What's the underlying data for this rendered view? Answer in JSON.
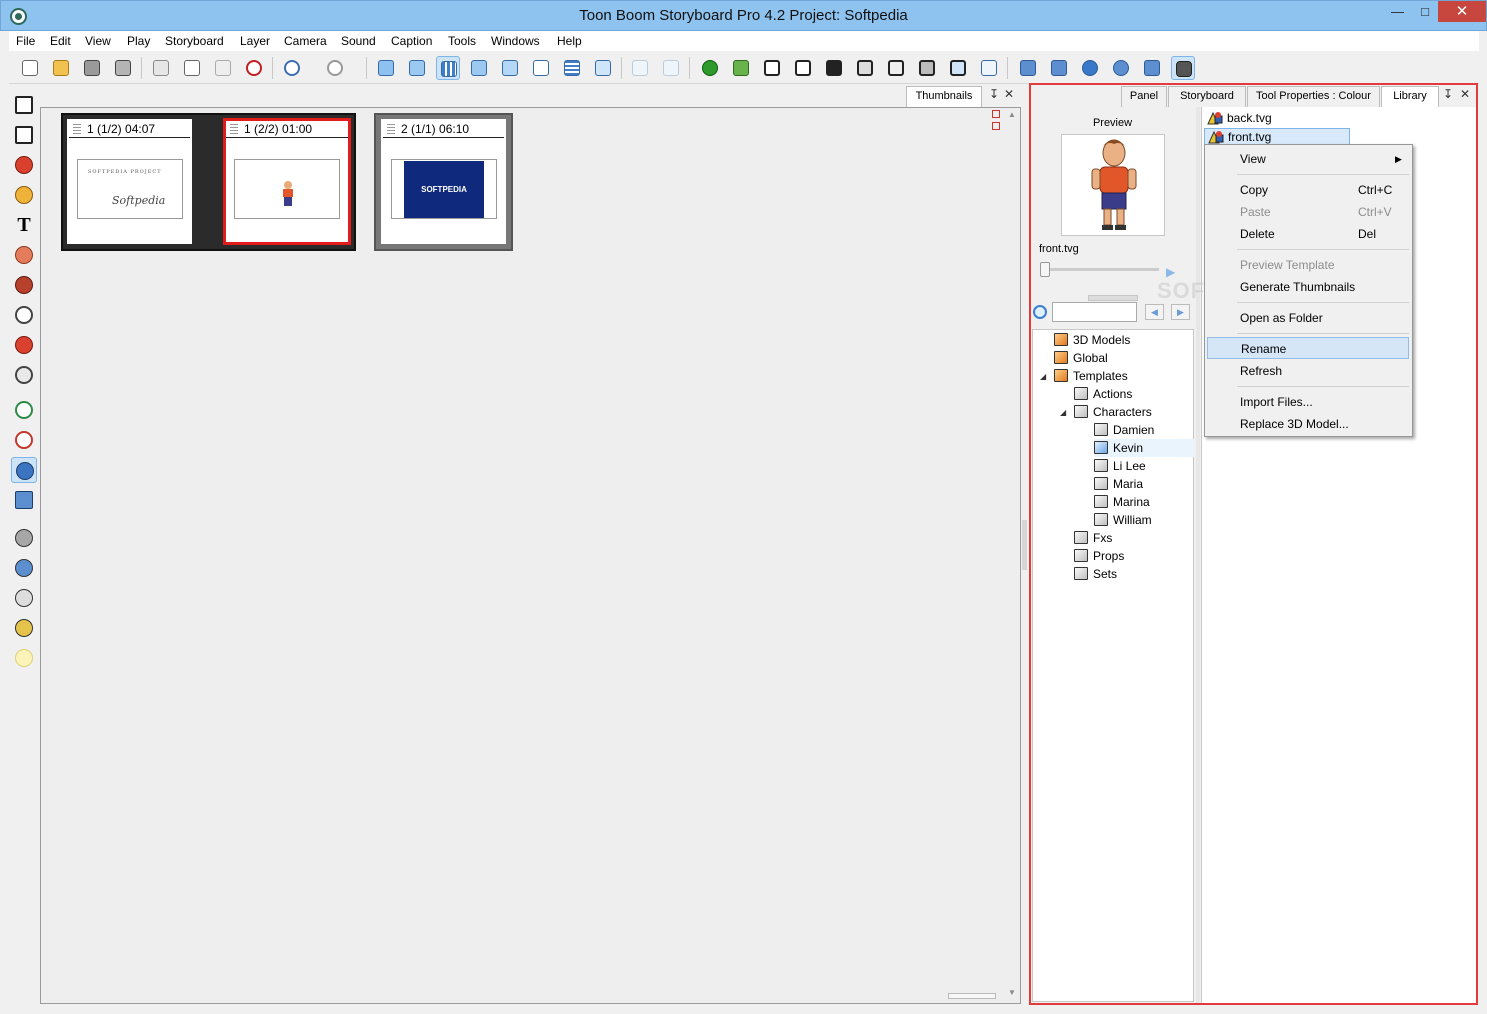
{
  "window": {
    "title": "Toon Boom Storyboard Pro 4.2 Project: Softpedia",
    "minimize": "—",
    "maximize": "□",
    "close": "✕"
  },
  "menu": [
    "File",
    "Edit",
    "View",
    "Play",
    "Storyboard",
    "Layer",
    "Camera",
    "Sound",
    "Caption",
    "Tools",
    "Windows",
    "Help"
  ],
  "toolbar_icons": [
    "new-icon",
    "open-icon",
    "save-icon",
    "save-as-icon",
    "cut-icon",
    "copy-icon",
    "paste-icon",
    "delete-icon",
    "undo-icon",
    "redo-icon",
    "timeline-view-icon",
    "storyboard-view-icon",
    "thumbnails-view-icon",
    "panel-view-icon",
    "row-view-icon",
    "stage-view-icon",
    "overview-icon",
    "camera-view-icon",
    "onion-skin-icon",
    "light-table-icon",
    "3d-icon",
    "grid-icon",
    "new-panel-icon",
    "new-scene-icon",
    "duplicate-icon",
    "split-icon",
    "smart-split-icon",
    "join-icon",
    "transition-icon",
    "cut-panel-icon",
    "first-frame-icon",
    "previous-frame-icon",
    "play-icon",
    "loop-icon",
    "sound-icon",
    "camera-icon"
  ],
  "left_tools": [
    "select-icon",
    "contour-editor-icon",
    "brush-icon",
    "pencil-icon",
    "text-tool",
    "eraser-icon",
    "paint-bucket-icon",
    "ellipse-icon",
    "eyedropper-icon",
    "hand-icon",
    "bezier-icon",
    "polyline-icon",
    "layer-transform-icon",
    "camera-transform-icon",
    "add-layer-icon",
    "add-vector-layer-icon",
    "delete-layer-icon",
    "lock-layer-icon",
    "light-icon"
  ],
  "thumbnails": {
    "tab": "Thumbnails",
    "panels": [
      {
        "label": "1 (1/2) 04:07",
        "content": "text",
        "line1": "SOFTPEDIA     PROJECT",
        "line2": "Softpedia"
      },
      {
        "label": "1 (2/2) 01:00",
        "content": "character"
      },
      {
        "label": "2 (1/1) 06:10",
        "content": "logo",
        "logo": "SOFTPEDIA"
      }
    ]
  },
  "dock": {
    "tabs": [
      "Panel",
      "Storyboard",
      "Tool Properties : Colour",
      "Library"
    ],
    "active_tab": "Library",
    "preview": {
      "label": "Preview",
      "filename": "front.tvg"
    },
    "tree": [
      {
        "label": "3D Models",
        "color": "orange"
      },
      {
        "label": "Global",
        "color": "orange"
      },
      {
        "label": "Templates",
        "color": "orange",
        "expanded": true
      },
      {
        "label": "Actions",
        "color": "gray"
      },
      {
        "label": "Characters",
        "color": "gray",
        "expanded": true
      },
      {
        "label": "Damien",
        "color": "gray"
      },
      {
        "label": "Kevin",
        "color": "blue",
        "selected": true
      },
      {
        "label": "Li Lee",
        "color": "gray"
      },
      {
        "label": "Maria",
        "color": "gray"
      },
      {
        "label": "Marina",
        "color": "gray"
      },
      {
        "label": "William",
        "color": "gray"
      },
      {
        "label": "Fxs",
        "color": "gray"
      },
      {
        "label": "Props",
        "color": "gray"
      },
      {
        "label": "Sets",
        "color": "gray"
      }
    ],
    "files": [
      {
        "label": "back.tvg"
      },
      {
        "label": "front.tvg",
        "selected": true
      }
    ]
  },
  "context_menu": {
    "view": "View",
    "copy": "Copy",
    "copy_sc": "Ctrl+C",
    "paste": "Paste",
    "paste_sc": "Ctrl+V",
    "delete": "Delete",
    "delete_sc": "Del",
    "preview_template": "Preview Template",
    "generate_thumbnails": "Generate Thumbnails",
    "open_as_folder": "Open as Folder",
    "rename": "Rename",
    "refresh": "Refresh",
    "import_files": "Import Files...",
    "replace_3d": "Replace 3D Model..."
  },
  "watermark": "SOFTPEDIA",
  "colors": {
    "accent": "#e13b3b",
    "selection": "#d5e6f7",
    "titlebar": "#8fc3ef",
    "close": "#c7463d",
    "logo_blue": "#0f2a7d"
  }
}
